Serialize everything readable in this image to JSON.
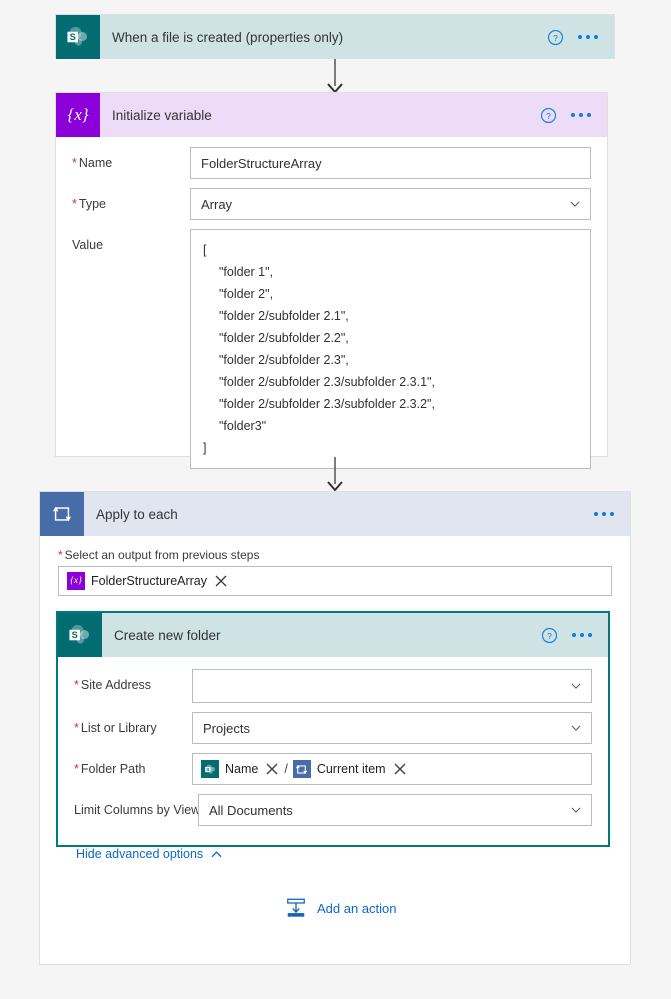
{
  "flow": {
    "trigger": {
      "title": "When a file is created (properties only)",
      "icon": "sharepoint-icon",
      "help_label": "?",
      "menu_label": "More commands"
    },
    "initialize_variable": {
      "title": "Initialize variable",
      "icon": "variable-icon",
      "icon_glyph": "{x}",
      "fields": {
        "name_label": "Name",
        "name_value": "FolderStructureArray",
        "type_label": "Type",
        "type_value": "Array",
        "value_label": "Value"
      },
      "value_json": {
        "open_bracket": "[",
        "items": [
          "\"folder 1\",",
          "\"folder 2\",",
          "\"folder 2/subfolder 2.1\",",
          "\"folder 2/subfolder 2.2\",",
          "\"folder 2/subfolder 2.3\",",
          "\"folder 2/subfolder 2.3/subfolder 2.3.1\",",
          "\"folder 2/subfolder 2.3/subfolder 2.3.2\",",
          "\"folder3\""
        ],
        "close_bracket": "]"
      }
    },
    "apply_to_each": {
      "title": "Apply to each",
      "icon": "loop-icon",
      "output_label": "Select an output from previous steps",
      "token": {
        "label": "FolderStructureArray",
        "icon": "variable-icon",
        "icon_glyph": "{x}",
        "remove_label": "Remove"
      }
    },
    "create_new_folder": {
      "title": "Create new folder",
      "icon": "sharepoint-icon",
      "fields": {
        "site_address_label": "Site Address",
        "site_address_value": "",
        "list_label": "List or Library",
        "list_value": "Projects",
        "folder_path_label": "Folder Path",
        "limit_columns_label": "Limit Columns by View",
        "limit_columns_value": "All Documents"
      },
      "folder_path_tokens": [
        {
          "label": "Name",
          "icon": "sharepoint-icon"
        },
        {
          "label": "Current item",
          "icon": "loop-icon"
        }
      ],
      "path_separator": "/",
      "advanced_link": "Hide advanced options"
    },
    "add_action": {
      "label": "Add an action",
      "icon": "add-action-icon"
    }
  },
  "colors": {
    "sharepoint": "#036c70",
    "variable": "#8b00d8",
    "loop": "#486ca8",
    "selected_border": "#007a7c",
    "link": "#0a69c7",
    "required": "#d13438",
    "page_bg": "#f5f5f5"
  }
}
